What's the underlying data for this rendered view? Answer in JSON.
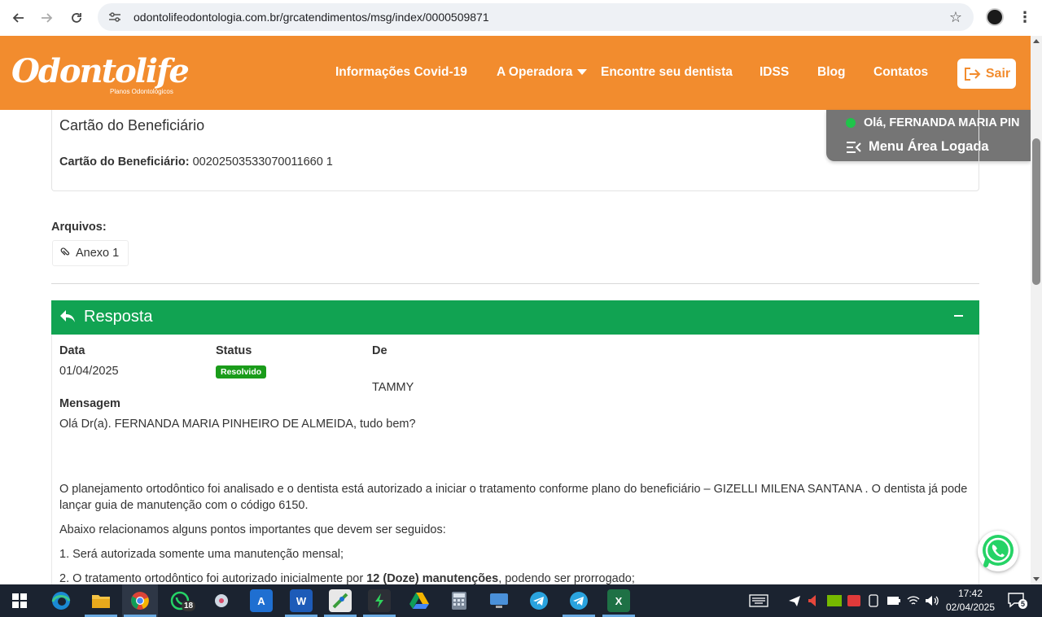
{
  "browser": {
    "url": "odontolifeodontologia.com.br/grcatendimentos/msg/index/0000509871"
  },
  "site": {
    "logo_text": "Odontolife",
    "logo_tagline": "Planos Odontológicos",
    "nav": [
      "Informações Covid-19",
      "A Operadora",
      "Encontre seu dentista",
      "IDSS",
      "Blog",
      "Contatos"
    ],
    "sair_label": "Sair",
    "brand_color": "#f28c2e"
  },
  "user_panel": {
    "greeting": "Olá, FERNANDA MARIA PIN",
    "menu_label": "Menu Área Logada",
    "status_color": "#1fc44a"
  },
  "beneficiario": {
    "title": "Cartão do Beneficiário",
    "label": "Cartão do Beneficiário:",
    "value": "00202503533070011660 1"
  },
  "arquivos": {
    "label": "Arquivos:",
    "items": [
      "Anexo 1"
    ]
  },
  "resposta": {
    "title": "Resposta",
    "header_color": "#11a352",
    "data_label": "Data",
    "data_value": "01/04/2025",
    "status_label": "Status",
    "status_value": "Resolvido",
    "de_label": "De",
    "de_value": "TAMMY",
    "mensagem_label": "Mensagem",
    "greeting": "Olá Dr(a). FERNANDA MARIA PINHEIRO DE ALMEIDA, tudo bem?",
    "paragraph_1": "O planejamento ortodôntico foi analisado e o dentista está autorizado a iniciar o tratamento conforme plano do beneficiário – GIZELLI MILENA SANTANA . O dentista já pode lançar guia de manutenção com o código 6150.",
    "paragraph_2": "Abaixo relacionamos alguns pontos importantes que devem ser seguidos:",
    "item_1": "1. Será autorizada somente uma manutenção mensal;",
    "item_2_pre": "2. O tratamento ortodôntico foi autorizado inicialmente por ",
    "item_2_bold": "12 (Doze) manutenções",
    "item_2_post": ", podendo ser prorrogado;"
  },
  "taskbar": {
    "whatsapp_badge": "18",
    "time": "17:42",
    "date": "02/04/2025",
    "notifications": "5"
  }
}
